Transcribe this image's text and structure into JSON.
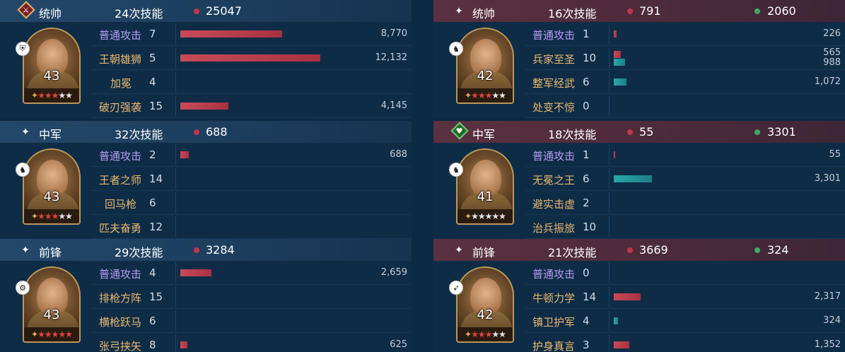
{
  "colors": {
    "damage_dot": "#c2344a",
    "heal_dot": "#3fa86a",
    "attack_skill": "#b59cf2",
    "skill": "#e8b86c",
    "damage_bar": "#c94a58",
    "heal_bar": "#2aa8a8"
  },
  "left": [
    {
      "position": "统帅",
      "position_icon": "emblem-red",
      "casts": "24次技能",
      "damage": "25047",
      "heal": "",
      "level": "43",
      "troop_icon": "shield-icon",
      "stars_red": 3,
      "stars_white": 2,
      "skills": [
        {
          "name": "普通攻击",
          "count": "7",
          "damage": "8,770",
          "damage_pct": 0.72,
          "heal": "",
          "heal_pct": 0,
          "attack": true
        },
        {
          "name": "王朝雄狮",
          "count": "5",
          "damage": "12,132",
          "damage_pct": 0.99,
          "heal": "",
          "heal_pct": 0,
          "attack": false
        },
        {
          "name": "加冕",
          "count": "4",
          "damage": "",
          "damage_pct": 0,
          "heal": "",
          "heal_pct": 0,
          "attack": false
        },
        {
          "name": "破刃强袭",
          "count": "15",
          "damage": "4,145",
          "damage_pct": 0.34,
          "heal": "",
          "heal_pct": 0,
          "attack": false
        }
      ]
    },
    {
      "position": "中军",
      "position_icon": "sparkle-icon",
      "casts": "32次技能",
      "damage": "688",
      "heal": "",
      "level": "43",
      "troop_icon": "horse-icon",
      "stars_red": 3,
      "stars_white": 2,
      "skills": [
        {
          "name": "普通攻击",
          "count": "2",
          "damage": "688",
          "damage_pct": 0.06,
          "heal": "",
          "heal_pct": 0,
          "attack": true
        },
        {
          "name": "王者之师",
          "count": "14",
          "damage": "",
          "damage_pct": 0,
          "heal": "",
          "heal_pct": 0,
          "attack": false
        },
        {
          "name": "回马枪",
          "count": "6",
          "damage": "",
          "damage_pct": 0,
          "heal": "",
          "heal_pct": 0,
          "attack": false
        },
        {
          "name": "匹夫奋勇",
          "count": "12",
          "damage": "",
          "damage_pct": 0,
          "heal": "",
          "heal_pct": 0,
          "attack": false
        }
      ]
    },
    {
      "position": "前锋",
      "position_icon": "sparkle-icon",
      "casts": "29次技能",
      "damage": "3284",
      "heal": "",
      "level": "43",
      "troop_icon": "cannon-icon",
      "stars_red": 5,
      "stars_white": 0,
      "skills": [
        {
          "name": "普通攻击",
          "count": "4",
          "damage": "2,659",
          "damage_pct": 0.22,
          "heal": "",
          "heal_pct": 0,
          "attack": true
        },
        {
          "name": "排枪方阵",
          "count": "15",
          "damage": "",
          "damage_pct": 0,
          "heal": "",
          "heal_pct": 0,
          "attack": false
        },
        {
          "name": "横枪跃马",
          "count": "6",
          "damage": "",
          "damage_pct": 0,
          "heal": "",
          "heal_pct": 0,
          "attack": false
        },
        {
          "name": "张弓挟矢",
          "count": "8",
          "damage": "625",
          "damage_pct": 0.05,
          "heal": "",
          "heal_pct": 0,
          "attack": false
        }
      ]
    }
  ],
  "right": [
    {
      "position": "统帅",
      "position_icon": "sparkle-icon",
      "casts": "16次技能",
      "damage": "791",
      "heal": "2060",
      "level": "42",
      "troop_icon": "horse-icon",
      "stars_red": 3,
      "stars_white": 2,
      "skills": [
        {
          "name": "普通攻击",
          "count": "1",
          "damage": "226",
          "damage_pct": 0.02,
          "heal": "",
          "heal_pct": 0,
          "attack": true
        },
        {
          "name": "兵家至圣",
          "count": "10",
          "damage": "565",
          "damage_pct": 0.05,
          "heal": "988",
          "heal_pct": 0.08,
          "attack": false
        },
        {
          "name": "整军经武",
          "count": "6",
          "damage": "",
          "damage_pct": 0,
          "heal": "1,072",
          "heal_pct": 0.09,
          "attack": false
        },
        {
          "name": "处变不惊",
          "count": "0",
          "damage": "",
          "damage_pct": 0,
          "heal": "",
          "heal_pct": 0,
          "attack": false
        }
      ]
    },
    {
      "position": "中军",
      "position_icon": "emblem-green",
      "casts": "18次技能",
      "damage": "55",
      "heal": "3301",
      "level": "41",
      "troop_icon": "horse-icon",
      "stars_red": 0,
      "stars_white": 5,
      "skills": [
        {
          "name": "普通攻击",
          "count": "1",
          "damage": "55",
          "damage_pct": 0.005,
          "heal": "",
          "heal_pct": 0,
          "attack": true
        },
        {
          "name": "无冕之王",
          "count": "6",
          "damage": "",
          "damage_pct": 0,
          "heal": "3,301",
          "heal_pct": 0.27,
          "attack": false
        },
        {
          "name": "避实击虚",
          "count": "2",
          "damage": "",
          "damage_pct": 0,
          "heal": "",
          "heal_pct": 0,
          "attack": false
        },
        {
          "name": "治兵振旅",
          "count": "10",
          "damage": "",
          "damage_pct": 0,
          "heal": "",
          "heal_pct": 0,
          "attack": false
        }
      ]
    },
    {
      "position": "前锋",
      "position_icon": "sparkle-icon",
      "casts": "21次技能",
      "damage": "3669",
      "heal": "324",
      "level": "42",
      "troop_icon": "bow-icon",
      "stars_red": 3,
      "stars_white": 2,
      "skills": [
        {
          "name": "普通攻击",
          "count": "0",
          "damage": "",
          "damage_pct": 0,
          "heal": "",
          "heal_pct": 0,
          "attack": true
        },
        {
          "name": "牛顿力学",
          "count": "14",
          "damage": "2,317",
          "damage_pct": 0.19,
          "heal": "",
          "heal_pct": 0,
          "attack": false
        },
        {
          "name": "镇卫护军",
          "count": "4",
          "damage": "",
          "damage_pct": 0,
          "heal": "324",
          "heal_pct": 0.03,
          "attack": false
        },
        {
          "name": "护身真言",
          "count": "3",
          "damage": "1,352",
          "damage_pct": 0.11,
          "heal": "",
          "heal_pct": 0,
          "attack": false
        }
      ]
    }
  ]
}
